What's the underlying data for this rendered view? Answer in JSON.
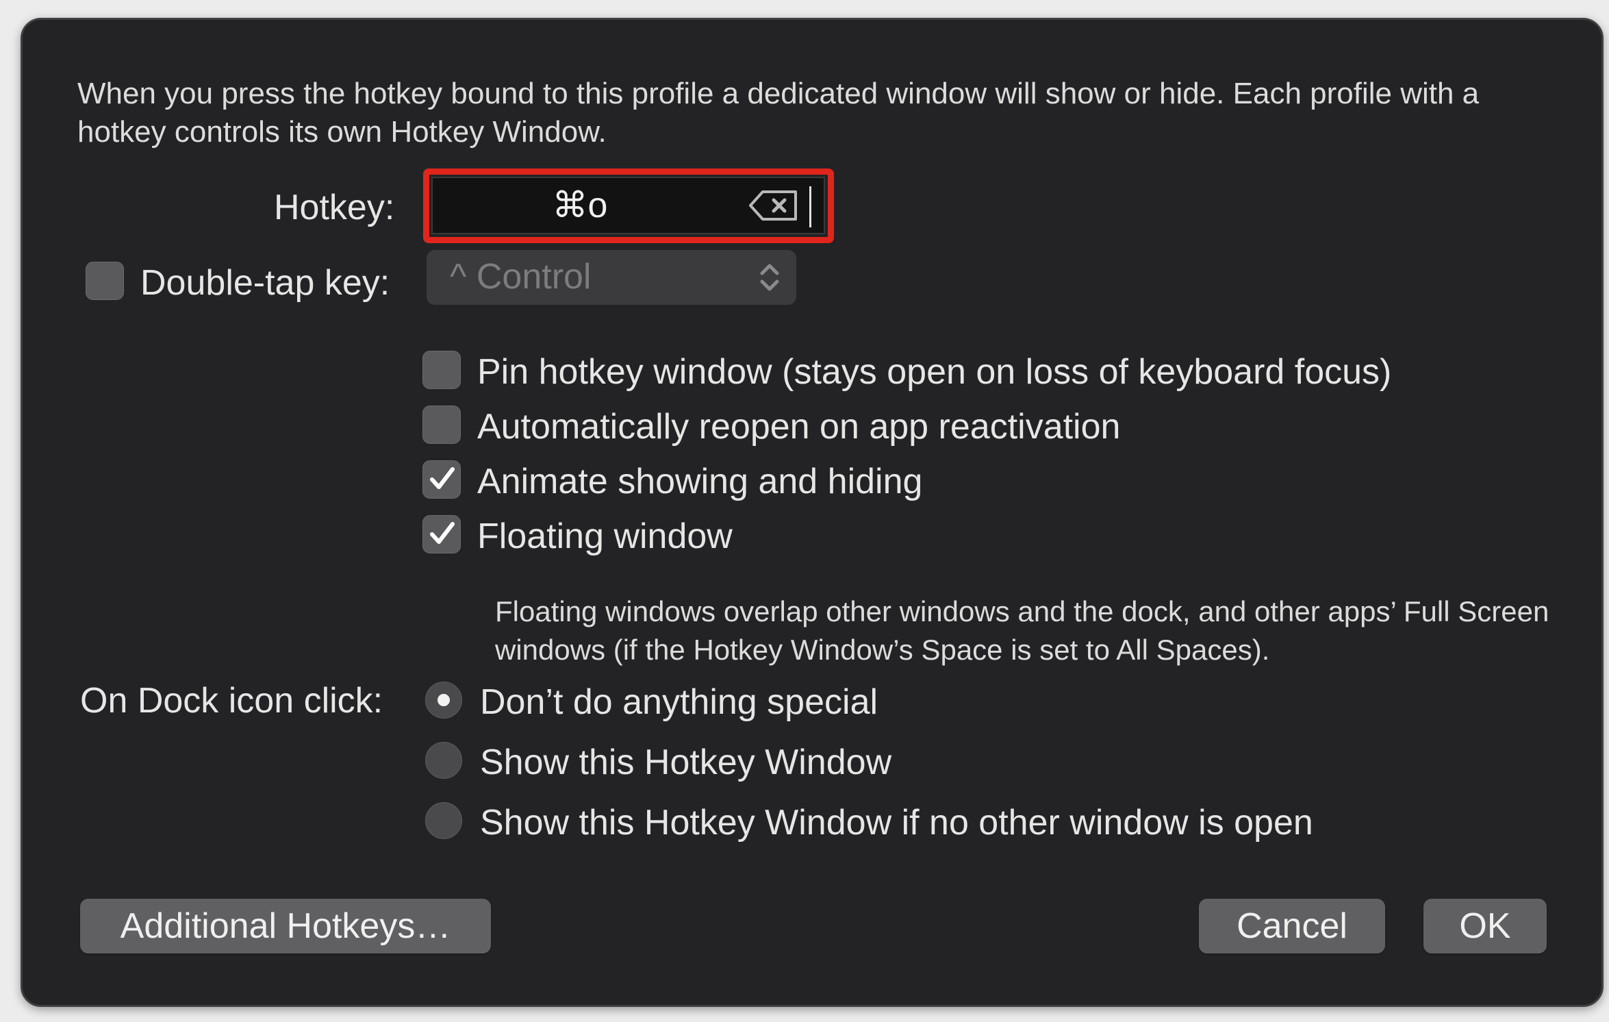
{
  "description": "When you press the hotkey bound to this profile a dedicated window will show or hide. Each profile with a hotkey controls its own Hotkey Window.",
  "hotkey": {
    "label": "Hotkey:",
    "value": "⌘o",
    "clear_icon": "delete-left-icon"
  },
  "double_tap": {
    "label": "Double-tap key:",
    "checked": false,
    "selected_key": "^ Control",
    "arrows_icon": "up-down-chevron-icon"
  },
  "options": [
    {
      "label": "Pin hotkey window (stays open on loss of keyboard focus)",
      "checked": false
    },
    {
      "label": "Automatically reopen on app reactivation",
      "checked": false
    },
    {
      "label": "Animate showing and hiding",
      "checked": true
    },
    {
      "label": "Floating window",
      "checked": true
    }
  ],
  "floating_note": "Floating windows overlap other windows and the dock, and other apps’ Full Screen windows (if the Hotkey Window’s Space is set to All Spaces).",
  "dock_click": {
    "label": "On Dock icon click:",
    "options": [
      {
        "label": "Don’t do anything special",
        "selected": true
      },
      {
        "label": "Show this Hotkey Window",
        "selected": false
      },
      {
        "label": "Show this Hotkey Window if no other window is open",
        "selected": false
      }
    ]
  },
  "buttons": {
    "additional": "Additional Hotkeys…",
    "cancel": "Cancel",
    "ok": "OK"
  },
  "colors": {
    "background": "#232325",
    "highlight": "#e0261c"
  }
}
